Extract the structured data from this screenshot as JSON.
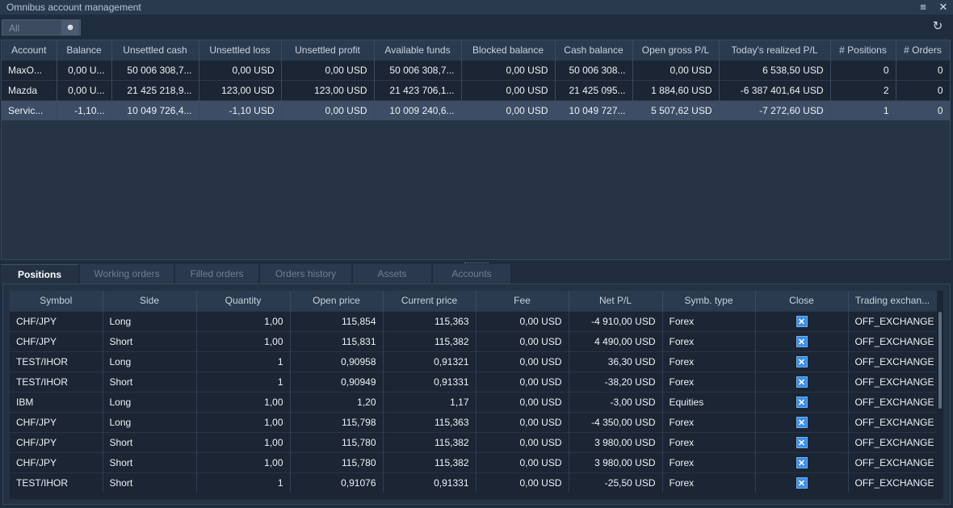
{
  "window": {
    "title": "Omnibus account management"
  },
  "filter": {
    "value": "All"
  },
  "accounts": {
    "columns": [
      "Account",
      "Balance",
      "Unsettled cash",
      "Unsettled loss",
      "Unsettled profit",
      "Available funds",
      "Blocked balance",
      "Cash balance",
      "Open gross P/L",
      "Today's realized P/L",
      "# Positions",
      "# Orders"
    ],
    "rows": [
      {
        "account": "MaxO...",
        "balance": "0,00 U...",
        "unsettled_cash": "50 006 308,7...",
        "unsettled_loss": "0,00 USD",
        "unsettled_profit": "0,00 USD",
        "available_funds": "50 006 308,7...",
        "blocked_balance": "0,00 USD",
        "cash_balance": "50 006 308...",
        "open_gross_pl": "0,00 USD",
        "todays_realized_pl": "6 538,50 USD",
        "positions": "0",
        "orders": "0"
      },
      {
        "account": "Mazda",
        "balance": "0,00 U...",
        "unsettled_cash": "21 425 218,9...",
        "unsettled_loss": "123,00 USD",
        "unsettled_profit": "123,00 USD",
        "available_funds": "21 423 706,1...",
        "blocked_balance": "0,00 USD",
        "cash_balance": "21 425 095...",
        "open_gross_pl": "1 884,60 USD",
        "todays_realized_pl": "-6 387 401,64 USD",
        "positions": "2",
        "orders": "0"
      },
      {
        "account": "Servic...",
        "balance": "-1,10...",
        "unsettled_cash": "10 049 726,4...",
        "unsettled_loss": "-1,10 USD",
        "unsettled_profit": "0,00 USD",
        "available_funds": "10 009 240,6...",
        "blocked_balance": "0,00 USD",
        "cash_balance": "10 049 727...",
        "open_gross_pl": "5 507,62 USD",
        "todays_realized_pl": "-7 272,60 USD",
        "positions": "1",
        "orders": "0"
      }
    ]
  },
  "tabs": [
    "Positions",
    "Working orders",
    "Filled orders",
    "Orders history",
    "Assets",
    "Accounts"
  ],
  "positions": {
    "columns": [
      "Symbol",
      "Side",
      "Quantity",
      "Open price",
      "Current price",
      "Fee",
      "Net P/L",
      "Symb. type",
      "Close",
      "Trading exchan..."
    ],
    "rows": [
      {
        "symbol": "CHF/JPY",
        "side": "Long",
        "quantity": "1,00",
        "open_price": "115,854",
        "current_price": "115,363",
        "fee": "0,00 USD",
        "net_pl": "-4 910,00 USD",
        "symb_type": "Forex",
        "exchange": "OFF_EXCHANGE"
      },
      {
        "symbol": "CHF/JPY",
        "side": "Short",
        "quantity": "1,00",
        "open_price": "115,831",
        "current_price": "115,382",
        "fee": "0,00 USD",
        "net_pl": "4 490,00 USD",
        "symb_type": "Forex",
        "exchange": "OFF_EXCHANGE"
      },
      {
        "symbol": "TEST/IHOR",
        "side": "Long",
        "quantity": "1",
        "open_price": "0,90958",
        "current_price": "0,91321",
        "fee": "0,00 USD",
        "net_pl": "36,30 USD",
        "symb_type": "Forex",
        "exchange": "OFF_EXCHANGE"
      },
      {
        "symbol": "TEST/IHOR",
        "side": "Short",
        "quantity": "1",
        "open_price": "0,90949",
        "current_price": "0,91331",
        "fee": "0,00 USD",
        "net_pl": "-38,20 USD",
        "symb_type": "Forex",
        "exchange": "OFF_EXCHANGE"
      },
      {
        "symbol": "IBM",
        "side": "Long",
        "quantity": "1,00",
        "open_price": "1,20",
        "current_price": "1,17",
        "fee": "0,00 USD",
        "net_pl": "-3,00 USD",
        "symb_type": "Equities",
        "exchange": "OFF_EXCHANGE"
      },
      {
        "symbol": "CHF/JPY",
        "side": "Long",
        "quantity": "1,00",
        "open_price": "115,798",
        "current_price": "115,363",
        "fee": "0,00 USD",
        "net_pl": "-4 350,00 USD",
        "symb_type": "Forex",
        "exchange": "OFF_EXCHANGE"
      },
      {
        "symbol": "CHF/JPY",
        "side": "Short",
        "quantity": "1,00",
        "open_price": "115,780",
        "current_price": "115,382",
        "fee": "0,00 USD",
        "net_pl": "3 980,00 USD",
        "symb_type": "Forex",
        "exchange": "OFF_EXCHANGE"
      },
      {
        "symbol": "CHF/JPY",
        "side": "Short",
        "quantity": "1,00",
        "open_price": "115,780",
        "current_price": "115,382",
        "fee": "0,00 USD",
        "net_pl": "3 980,00 USD",
        "symb_type": "Forex",
        "exchange": "OFF_EXCHANGE"
      },
      {
        "symbol": "TEST/IHOR",
        "side": "Short",
        "quantity": "1",
        "open_price": "0,91076",
        "current_price": "0,91331",
        "fee": "0,00 USD",
        "net_pl": "-25,50 USD",
        "symb_type": "Forex",
        "exchange": "OFF_EXCHANGE"
      }
    ]
  },
  "colors": {
    "long": "#4aa3e8",
    "short": "#f26b4f",
    "symbol": "#f0b429",
    "negative": "#ff3b3b",
    "positive": "#b6d937",
    "close_button": "#3a8ee6"
  },
  "icons": {
    "window_menu": "menu-icon",
    "close": "close-icon",
    "filter_user": "user-list-icon",
    "refresh": "refresh-icon",
    "position_close": "close-box-icon"
  }
}
